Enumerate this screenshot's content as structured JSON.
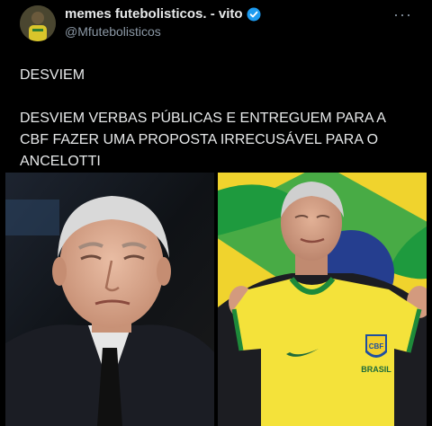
{
  "account": {
    "display_name": "memes futebolisticos. - vito",
    "handle": "@Mfutebolisticos",
    "verified_icon": "verified-badge-icon",
    "more_icon": "more-options-icon"
  },
  "tweet": {
    "line1": "DESVIEM",
    "line2": "DESVIEM VERBAS PÚBLICAS E ENTREGUEM PARA A CBF FAZER UMA PROPOSTA IRRECUSÁVEL PARA O ANCELOTTI"
  },
  "media": {
    "jersey_text": "BRASIL"
  },
  "colors": {
    "background": "#000000",
    "text": "#e7e9ea",
    "secondary_text": "#8b98a5",
    "verified_blue": "#1d9bf0",
    "brazil_yellow": "#f2dd36",
    "brazil_green": "#1e9a3e"
  }
}
